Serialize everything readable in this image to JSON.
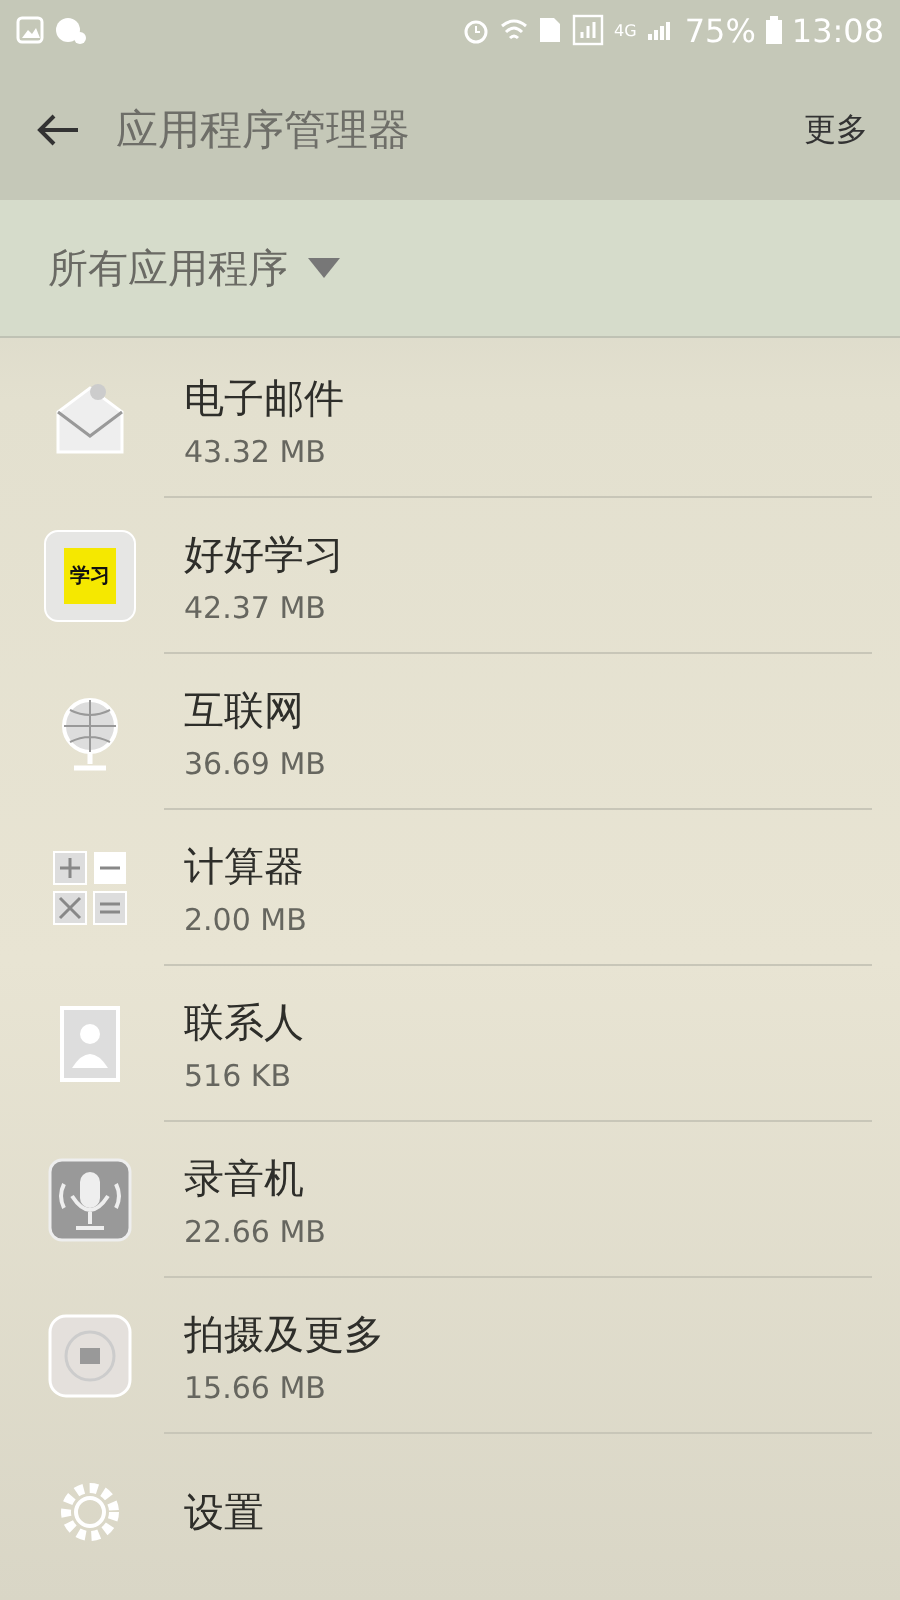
{
  "status_bar": {
    "network": "4G",
    "battery": "75%",
    "time": "13:08"
  },
  "app_bar": {
    "title": "应用程序管理器",
    "more": "更多"
  },
  "filter": {
    "label": "所有应用程序"
  },
  "apps": [
    {
      "kind": "mail",
      "name": "电子邮件",
      "size": "43.32 MB"
    },
    {
      "kind": "badge",
      "badge_text": "学习",
      "name": "好好学习",
      "size": "42.37 MB"
    },
    {
      "kind": "globe",
      "name": "互联网",
      "size": "36.69 MB"
    },
    {
      "kind": "calculator",
      "name": "计算器",
      "size": "2.00 MB"
    },
    {
      "kind": "contacts",
      "name": "联系人",
      "size": "516 KB"
    },
    {
      "kind": "recorder",
      "name": "录音机",
      "size": "22.66 MB"
    },
    {
      "kind": "camera",
      "name": "拍摄及更多",
      "size": "15.66 MB"
    },
    {
      "kind": "gear",
      "name": "设置"
    }
  ]
}
